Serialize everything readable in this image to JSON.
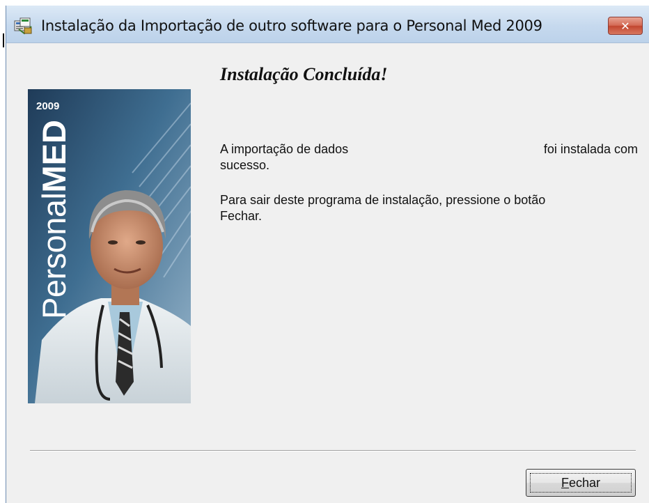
{
  "window": {
    "title": "Instalação da Importação de outro software para o Personal Med 2009",
    "close_glyph": "✕"
  },
  "side_image": {
    "year": "2009",
    "brand_light": "Personal",
    "brand_bold": "MED"
  },
  "content": {
    "heading": "Instalação Concluída!",
    "message1_part1": "A importação de dados",
    "message1_part2": "foi instalada com",
    "message1_line2": "sucesso.",
    "message2_line1": "Para sair deste programa de instalação, pressione o botão",
    "message2_line2": "Fechar."
  },
  "buttons": {
    "close_mnemonic": "F",
    "close_rest": "echar"
  },
  "icons": {
    "app": "installer-icon",
    "close": "close-icon"
  },
  "colors": {
    "close_button": "#c9503a",
    "titlebar": "#c6d9ee",
    "dialog_background": "#f0f0f0"
  }
}
